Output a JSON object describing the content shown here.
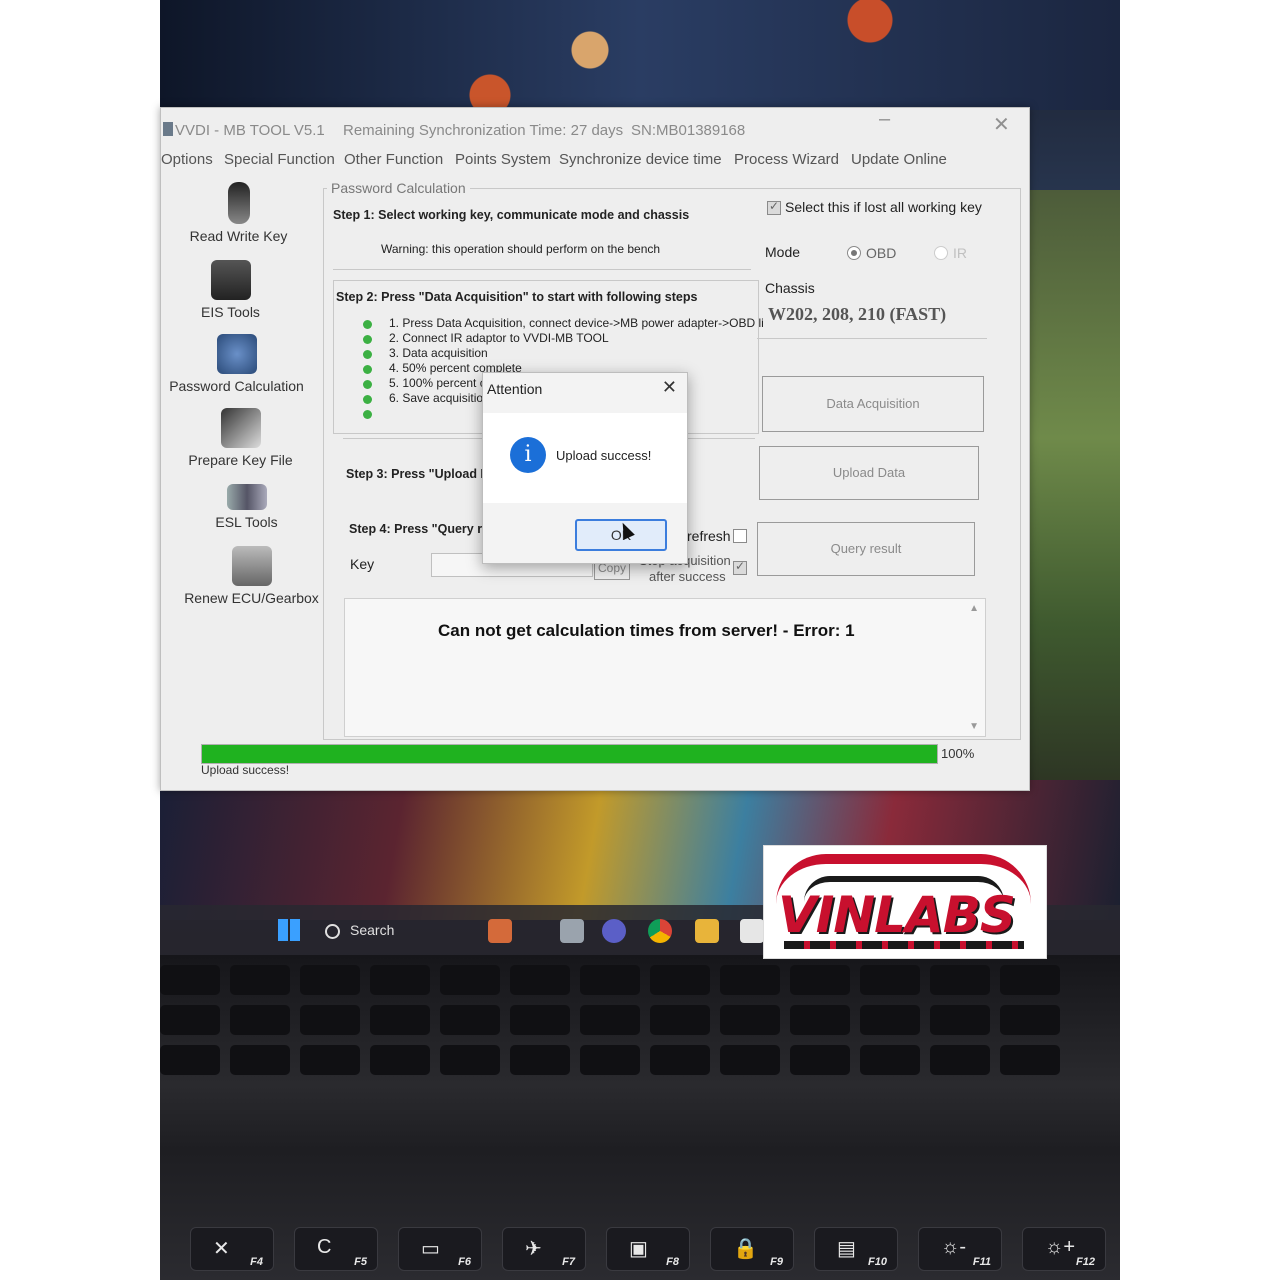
{
  "window": {
    "title": "VVDI - MB TOOL V5.1",
    "remaining_sync": "Remaining Synchronization Time: 27 days",
    "serial": "SN:MB01389168",
    "minimize_icon": "minimize-icon",
    "close_icon": "close-icon"
  },
  "menu": [
    "Options",
    "Special Function",
    "Other Function",
    "Points System",
    "Synchronize device time",
    "Process Wizard",
    "Update Online"
  ],
  "sidebar": [
    {
      "label": "Read Write Key",
      "icon": "car-key-icon"
    },
    {
      "label": "EIS Tools",
      "icon": "ignition-switch-icon"
    },
    {
      "label": "Password Calculation",
      "icon": "gears-icon"
    },
    {
      "label": "Prepare Key File",
      "icon": "key-file-icon"
    },
    {
      "label": "ESL Tools",
      "icon": "steering-lock-icon"
    },
    {
      "label": "Renew ECU/Gearbox",
      "icon": "ecu-icon"
    }
  ],
  "password_calc": {
    "group_title": "Password Calculation",
    "step1": "Step 1: Select working key, communicate mode and chassis",
    "warning": "Warning: this operation should perform on the bench",
    "lost_keys_label": "Select this if lost all working key",
    "lost_keys_checked": true,
    "mode_label": "Mode",
    "mode_options": [
      "OBD",
      "IR"
    ],
    "mode_selected": "OBD",
    "chassis_label": "Chassis",
    "chassis_value": "W202, 208, 210 (FAST)",
    "step2": "Step 2: Press \"Data Acquisition\" to start with following steps",
    "step2_items": [
      "1. Press Data Acquisition, connect device->MB power adapter->OBD li",
      "2. Connect IR adaptor to VVDI-MB TOOL",
      "3. Data acquisition",
      "4. 50%  percent complete",
      "5. 100% percent co",
      "6. Save acquisition",
      ""
    ],
    "data_acquisition_btn": "Data Acquisition",
    "step3": "Step 3: Press \"Upload Da",
    "upload_btn": "Upload Data",
    "step4": "Step 4: Press \"Query res",
    "refresh_label": "refresh",
    "stop_label_1": "Stop acquisition",
    "stop_label_2": "after success",
    "query_btn": "Query result",
    "key_label": "Key",
    "key_value": "",
    "copy_btn": "Copy"
  },
  "log": {
    "message": "Can not get calculation times from server! - Error: 1"
  },
  "progress": {
    "percent": 100,
    "label": "100%"
  },
  "status": "Upload success!",
  "dialog": {
    "title": "Attention",
    "message": "Upload success!",
    "ok": "OK",
    "icon": "info-icon"
  },
  "taskbar": {
    "search": "Search"
  },
  "keyboard": {
    "fkeys": [
      {
        "sym": "✕",
        "label": "F4"
      },
      {
        "sym": "C",
        "label": "F5"
      },
      {
        "sym": "▭",
        "label": "F6"
      },
      {
        "sym": "✈",
        "label": "F7"
      },
      {
        "sym": "▣",
        "label": "F8"
      },
      {
        "sym": "🔒",
        "label": "F9"
      },
      {
        "sym": "▤",
        "label": "F10"
      },
      {
        "sym": "☼-",
        "label": "F11"
      },
      {
        "sym": "☼+",
        "label": "F12"
      }
    ]
  },
  "logo": {
    "text": "VINLABS"
  },
  "colors": {
    "progress": "#1fb21f",
    "accent": "#3b7ddd",
    "logo_red": "#c8102e"
  }
}
